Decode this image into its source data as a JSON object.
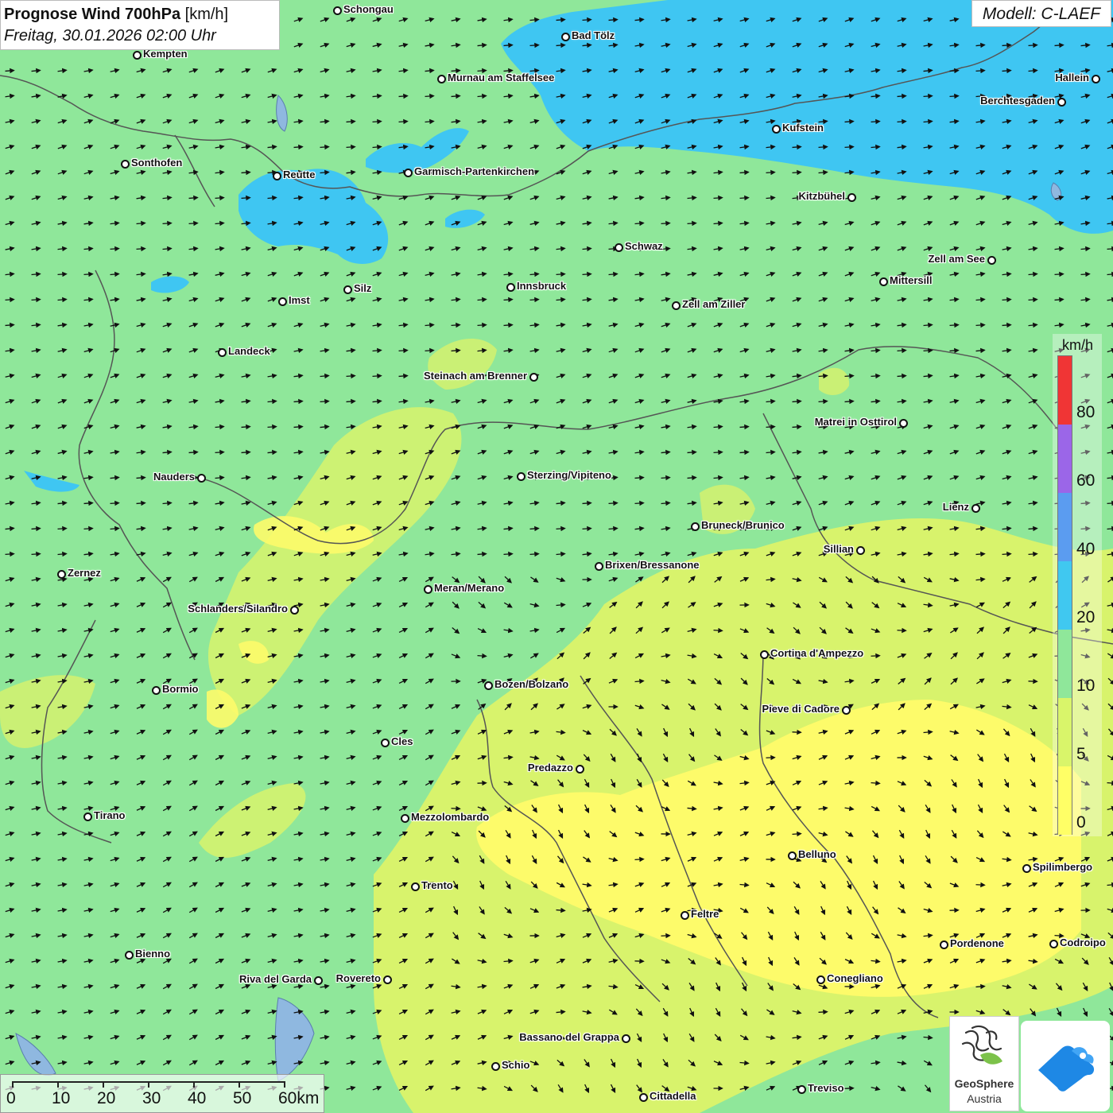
{
  "header": {
    "title_bold": "Prognose Wind 700hPa",
    "title_unit": "[km/h]",
    "subtitle": "Freitag, 30.01.2026 02:00 Uhr"
  },
  "model": {
    "label": "Modell: C-LAEF"
  },
  "legend": {
    "unit": "km/h",
    "bins": [
      {
        "from": 0,
        "to": 5,
        "color": "#ffff66"
      },
      {
        "from": 5,
        "to": 10,
        "color": "#d9f56a"
      },
      {
        "from": 10,
        "to": 20,
        "color": "#8fe79a"
      },
      {
        "from": 20,
        "to": 40,
        "color": "#40c8f0"
      },
      {
        "from": 40,
        "to": 60,
        "color": "#5b9cf0"
      },
      {
        "from": 60,
        "to": 80,
        "color": "#9b66e8"
      },
      {
        "from": 80,
        "to": 100,
        "color": "#f03535"
      }
    ],
    "ticks": [
      "80",
      "60",
      "40",
      "20",
      "10",
      "5",
      "0"
    ]
  },
  "scale_bar": {
    "ticks": [
      "0",
      "10",
      "20",
      "30",
      "40",
      "50",
      "60km"
    ]
  },
  "logos": {
    "geosphere_line1": "GeoSphere",
    "geosphere_line2": "Austria"
  },
  "map": {
    "cities": [
      {
        "name": "Schongau"
      },
      {
        "name": "Bad Tölz"
      },
      {
        "name": "Kempten"
      },
      {
        "name": "Murnau am Staffelsee"
      },
      {
        "name": "Hallein"
      },
      {
        "name": "Berchtesgaden"
      },
      {
        "name": "Kufstein"
      },
      {
        "name": "Sonthofen"
      },
      {
        "name": "Reutte"
      },
      {
        "name": "Garmisch-Partenkirchen"
      },
      {
        "name": "Kitzbühel"
      },
      {
        "name": "Schwaz"
      },
      {
        "name": "Zell am See"
      },
      {
        "name": "Mittersill"
      },
      {
        "name": "Innsbruck"
      },
      {
        "name": "Silz"
      },
      {
        "name": "Imst"
      },
      {
        "name": "Zell am Ziller"
      },
      {
        "name": "Landeck"
      },
      {
        "name": "Steinach am Brenner"
      },
      {
        "name": "Matrei in Osttirol"
      },
      {
        "name": "Nauders"
      },
      {
        "name": "Sterzing/Vipiteno"
      },
      {
        "name": "Lienz"
      },
      {
        "name": "Bruneck/Brunico"
      },
      {
        "name": "Sillian"
      },
      {
        "name": "Brixen/Bressanone"
      },
      {
        "name": "Zernez"
      },
      {
        "name": "Meran/Merano"
      },
      {
        "name": "Schlanders/Silandro"
      },
      {
        "name": "Cortina d'Ampezzo"
      },
      {
        "name": "Bozen/Bolzano"
      },
      {
        "name": "Bormio"
      },
      {
        "name": "Pieve di Cadore"
      },
      {
        "name": "Cles"
      },
      {
        "name": "Predazzo"
      },
      {
        "name": "Tirano"
      },
      {
        "name": "Mezzolombardo"
      },
      {
        "name": "Belluno"
      },
      {
        "name": "Spilimbergo"
      },
      {
        "name": "Trento"
      },
      {
        "name": "Feltre"
      },
      {
        "name": "Pordenone"
      },
      {
        "name": "Codroipo"
      },
      {
        "name": "Bienno"
      },
      {
        "name": "Riva del Garda"
      },
      {
        "name": "Rovereto"
      },
      {
        "name": "Conegliano"
      },
      {
        "name": "Bassano del Grappa"
      },
      {
        "name": "Schio"
      },
      {
        "name": "Treviso"
      },
      {
        "name": "Cittadella"
      }
    ]
  }
}
